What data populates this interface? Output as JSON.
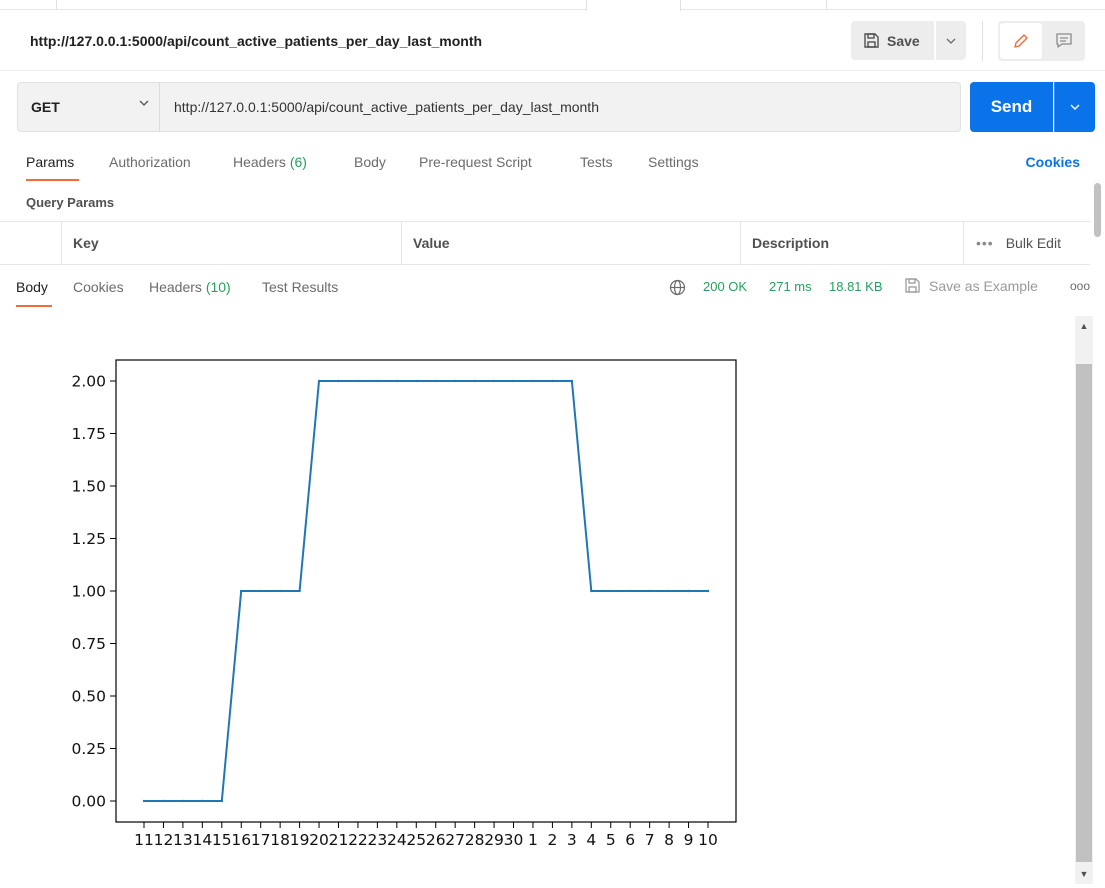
{
  "request": {
    "title": "http://127.0.0.1:5000/api/count_active_patients_per_day_last_month",
    "save_label": "Save",
    "method": "GET",
    "url": "http://127.0.0.1:5000/api/count_active_patients_per_day_last_month",
    "send_label": "Send",
    "tabs": [
      {
        "label": "Params",
        "count": ""
      },
      {
        "label": "Authorization",
        "count": ""
      },
      {
        "label": "Headers",
        "count": "(6)"
      },
      {
        "label": "Body",
        "count": ""
      },
      {
        "label": "Pre-request Script",
        "count": ""
      },
      {
        "label": "Tests",
        "count": ""
      },
      {
        "label": "Settings",
        "count": ""
      }
    ],
    "cookies_label": "Cookies",
    "query_params_title": "Query Params",
    "table_headers": {
      "key": "Key",
      "value": "Value",
      "description": "Description",
      "bulk_edit": "Bulk Edit"
    }
  },
  "response": {
    "tabs": [
      {
        "label": "Body",
        "count": ""
      },
      {
        "label": "Cookies",
        "count": ""
      },
      {
        "label": "Headers",
        "count": "(10)"
      },
      {
        "label": "Test Results",
        "count": ""
      }
    ],
    "status": "200 OK",
    "time": "271 ms",
    "size": "18.81 KB",
    "save_example_label": "Save as Example"
  },
  "colors": {
    "accent_orange": "#f26b3a",
    "send_blue": "#0a73ea",
    "status_green": "#26a05a",
    "line_blue": "#1f77b4"
  },
  "chart_data": {
    "type": "line",
    "categories": [
      "11",
      "12",
      "13",
      "14",
      "15",
      "16",
      "17",
      "18",
      "19",
      "20",
      "21",
      "22",
      "23",
      "24",
      "25",
      "26",
      "27",
      "28",
      "29",
      "30",
      "1",
      "2",
      "3",
      "4",
      "5",
      "6",
      "7",
      "8",
      "9",
      "10"
    ],
    "values": [
      0,
      0,
      0,
      0,
      0,
      1,
      1,
      1,
      1,
      2,
      2,
      2,
      2,
      2,
      2,
      2,
      2,
      2,
      2,
      2,
      2,
      2,
      2,
      1,
      1,
      1,
      1,
      1,
      1,
      1
    ],
    "y_ticks": [
      "0.00",
      "0.25",
      "0.50",
      "0.75",
      "1.00",
      "1.25",
      "1.50",
      "1.75",
      "2.00"
    ],
    "ylim": [
      -0.1,
      2.1
    ],
    "title": "",
    "xlabel": "",
    "ylabel": ""
  }
}
